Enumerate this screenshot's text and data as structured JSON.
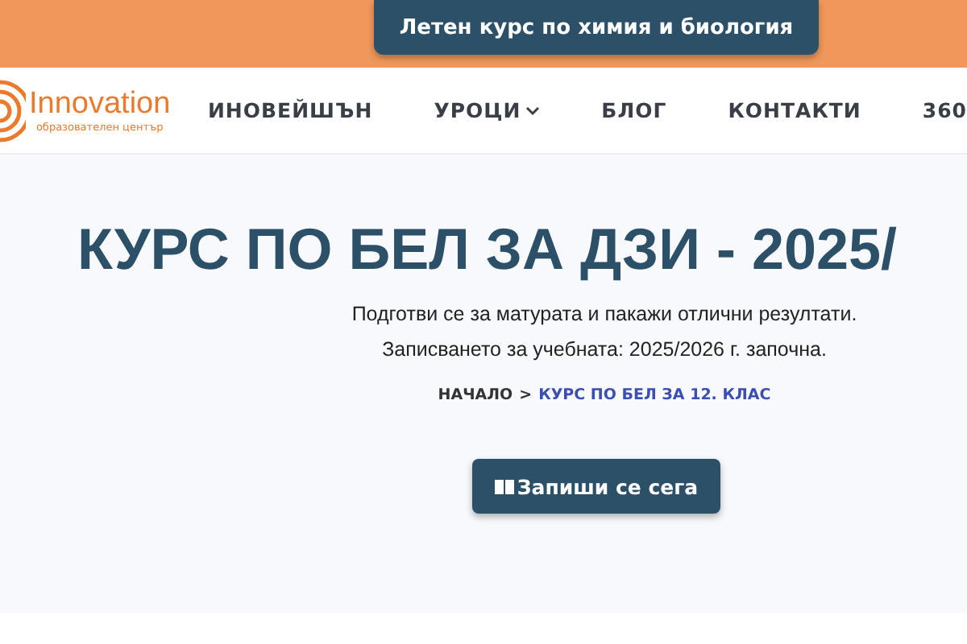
{
  "promo": {
    "label": "Летен курс по химия и биология"
  },
  "logo": {
    "name": "Innovation",
    "tagline": "образователен център"
  },
  "nav": [
    {
      "label": "ИНОВЕЙШЪН",
      "dropdown": false
    },
    {
      "label": "УРОЦИ",
      "dropdown": true
    },
    {
      "label": "БЛОГ",
      "dropdown": false
    },
    {
      "label": "КОНТАКТИ",
      "dropdown": false
    },
    {
      "label": "360",
      "dropdown": false
    }
  ],
  "hero": {
    "title": "КУРС ПО БЕЛ ЗА ДЗИ - 2025/",
    "lead": "Подготви се за матурата и пакажи отлични резултати. Записването за учебната: 2025/2026 г. започна.",
    "breadcrumb": [
      {
        "label": "НАЧАЛО",
        "current": false
      },
      {
        "label": "КУРС ПО БЕЛ ЗА 12. КЛАС",
        "current": true
      }
    ],
    "separator": ">",
    "cta": "Запиши се сега"
  }
}
